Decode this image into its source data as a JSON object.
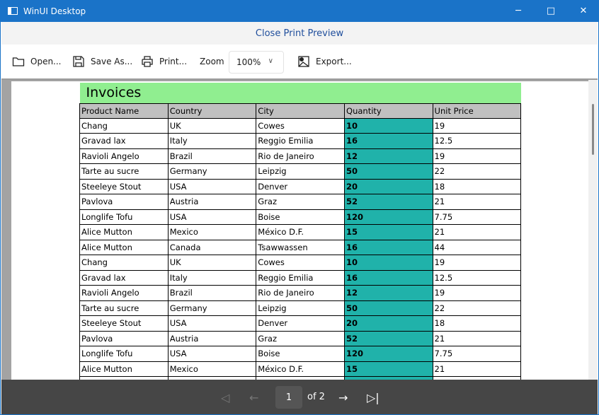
{
  "window": {
    "title": "WinUI Desktop"
  },
  "close_preview": "Close Print Preview",
  "toolbar": {
    "open": "Open...",
    "save_as": "Save As...",
    "print": "Print...",
    "zoom_label": "Zoom",
    "zoom_value": "100%",
    "export": "Export..."
  },
  "report": {
    "title": "Invoices",
    "columns": [
      "Product Name",
      "Country",
      "City",
      "Quantity",
      "Unit Price"
    ],
    "rows": [
      [
        "Chang",
        "UK",
        "Cowes",
        "10",
        "19"
      ],
      [
        "Gravad lax",
        "Italy",
        "Reggio Emilia",
        "16",
        "12.5"
      ],
      [
        "Ravioli Angelo",
        "Brazil",
        "Rio de Janeiro",
        "12",
        "19"
      ],
      [
        "Tarte au sucre",
        "Germany",
        "Leipzig",
        "50",
        "22"
      ],
      [
        "Steeleye Stout",
        "USA",
        "Denver",
        "20",
        "18"
      ],
      [
        "Pavlova",
        "Austria",
        "Graz",
        "52",
        "21"
      ],
      [
        "Longlife Tofu",
        "USA",
        "Boise",
        "120",
        "7.75"
      ],
      [
        "Alice Mutton",
        "Mexico",
        "México D.F.",
        "15",
        "21"
      ],
      [
        "Alice Mutton",
        "Canada",
        "Tsawwassen",
        "16",
        "44"
      ],
      [
        "Chang",
        "UK",
        "Cowes",
        "10",
        "19"
      ],
      [
        "Gravad lax",
        "Italy",
        "Reggio Emilia",
        "16",
        "12.5"
      ],
      [
        "Ravioli Angelo",
        "Brazil",
        "Rio de Janeiro",
        "12",
        "19"
      ],
      [
        "Tarte au sucre",
        "Germany",
        "Leipzig",
        "50",
        "22"
      ],
      [
        "Steeleye Stout",
        "USA",
        "Denver",
        "20",
        "18"
      ],
      [
        "Pavlova",
        "Austria",
        "Graz",
        "52",
        "21"
      ],
      [
        "Longlife Tofu",
        "USA",
        "Boise",
        "120",
        "7.75"
      ],
      [
        "Alice Mutton",
        "Mexico",
        "México D.F.",
        "15",
        "21"
      ]
    ]
  },
  "pager": {
    "current": "1",
    "of_label": "of 2"
  },
  "colors": {
    "title_bg": "#90ee90",
    "header_bg": "#c0c0c0",
    "quantity_bg": "#20b2aa",
    "accent": "#1a73c8"
  }
}
